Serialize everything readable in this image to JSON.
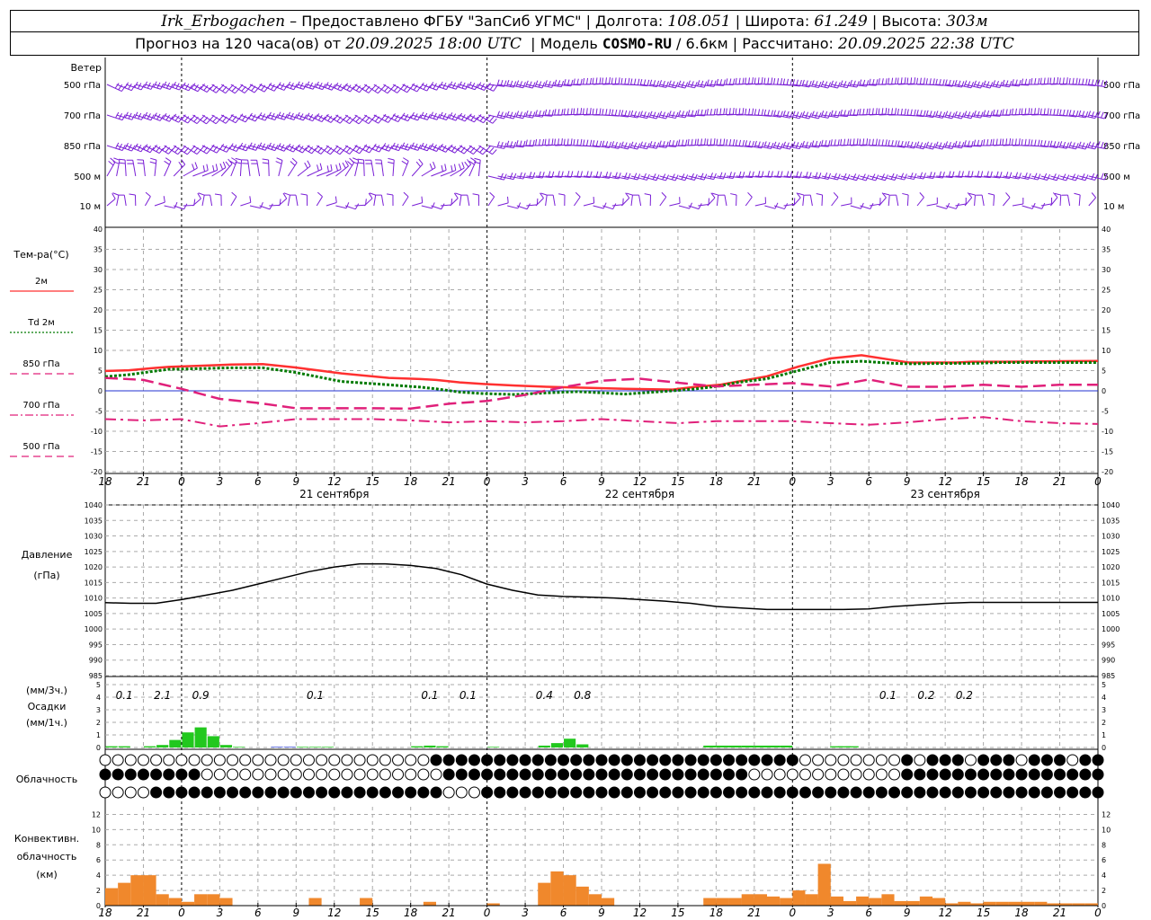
{
  "header": {
    "station": "Irk_Erbogachen",
    "dash": " – ",
    "provided": "Предоставлено ФГБУ \"ЗапСиб УГМС\"",
    "lon_label": "Долгота:",
    "lon": "108.051",
    "lat_label": "Широта:",
    "lat": "61.249",
    "alt_label": "Высота:",
    "alt": "303м",
    "forecast": "Прогноз на 120 часа(ов) от",
    "start": "20.09.2025 18:00 UTC",
    "model_label": "Модель",
    "model": "COSMO-RU",
    "res": " / 6.6км",
    "calc_label": "Рассчитано:",
    "calc": "20.09.2025 22:38 UTC"
  },
  "wind_panel": {
    "title": "Ветер",
    "levels": [
      "500 гПа",
      "700 гПа",
      "850 гПа",
      "500 м",
      "10  м"
    ]
  },
  "temp_panel": {
    "title": "Тем-ра(°C)",
    "legend": [
      {
        "label": "2м",
        "style": "solid",
        "color": "#ff3030"
      },
      {
        "label": "Td  2м",
        "style": "dotted",
        "color": "#007a00"
      },
      {
        "label": "850 гПа",
        "style": "dashed",
        "color": "#e0207a"
      },
      {
        "label": "700 гПа",
        "style": "dashdot",
        "color": "#e0207a"
      },
      {
        "label": "500 гПа",
        "style": "dashed",
        "color": "#e0207a"
      }
    ],
    "ticks": [
      "40",
      "35",
      "30",
      "25",
      "20",
      "15",
      "10",
      "5",
      "0",
      "-5",
      "-10",
      "-15",
      "-20"
    ]
  },
  "time_axis": {
    "hours": [
      "18",
      "21",
      "0",
      "3",
      "6",
      "9",
      "12",
      "15",
      "18",
      "21",
      "0",
      "3",
      "6",
      "9",
      "12",
      "15",
      "18",
      "21",
      "0",
      "3",
      "6",
      "9",
      "12",
      "15",
      "18",
      "21",
      "0"
    ],
    "dates": [
      "21 сентября",
      "22 сентября",
      "23 сентября"
    ]
  },
  "pressure_panel": {
    "title": "Давление",
    "unit": "(гПа)",
    "ticks": [
      "1040",
      "1035",
      "1030",
      "1025",
      "1020",
      "1015",
      "1010",
      "1005",
      "1000",
      "995",
      "990",
      "985"
    ]
  },
  "precip_panel": {
    "unit3": "(мм/3ч.)",
    "title": "Осадки",
    "unit1": "(мм/1ч.)",
    "ticks": [
      "5",
      "4",
      "3",
      "2",
      "1",
      "0"
    ],
    "totals_3h": [
      {
        "h": 1.5,
        "text": "0.1"
      },
      {
        "h": 4.5,
        "text": "2.1"
      },
      {
        "h": 7.5,
        "text": "0.9"
      },
      {
        "h": 16.5,
        "text": "0.1"
      },
      {
        "h": 25.5,
        "text": "0.1"
      },
      {
        "h": 28.5,
        "text": "0.1"
      },
      {
        "h": 34.5,
        "text": "0.4"
      },
      {
        "h": 37.5,
        "text": "0.8"
      },
      {
        "h": 61.5,
        "text": "0.1"
      },
      {
        "h": 64.5,
        "text": "0.2"
      },
      {
        "h": 67.5,
        "text": "0.2"
      },
      {
        "h": 94.5,
        "text": "0.1"
      }
    ]
  },
  "cloud_panel": {
    "title": "Облачность"
  },
  "conv_panel": {
    "title1": "Конвективн.",
    "title2": "облачность",
    "unit": "(км)",
    "ticks": [
      "12",
      "10",
      "8",
      "6",
      "4",
      "2",
      "0"
    ]
  },
  "chart_data": {
    "type": "line",
    "x_unit": "hours since 20.09.2025 18:00 UTC",
    "x_range": [
      0,
      78
    ],
    "temperature": {
      "ylim": [
        -20,
        40
      ],
      "series": [
        {
          "name": "2м",
          "x": [
            0,
            3,
            6,
            8,
            12,
            16,
            20,
            24,
            30,
            36,
            40,
            42,
            45,
            48,
            52,
            56,
            60,
            66,
            72,
            75,
            78,
            80,
            84,
            88,
            92,
            96,
            100,
            102,
            108,
            110,
            114,
            120,
            126
          ],
          "values": [
            4.9,
            5.1,
            5.6,
            5.9,
            6.2,
            6.5,
            6.6,
            5.8,
            4.3,
            3.2,
            2.9,
            2.7,
            2.1,
            1.7,
            1.3,
            1.0,
            0.8,
            0.5,
            0.3,
            1.0,
            1.5,
            2.2,
            3.6,
            6.0,
            8.0,
            8.8,
            7.6,
            7.0,
            7.0,
            7.2,
            7.2,
            7.3,
            7.4
          ]
        },
        {
          "name": "Td  2м",
          "x": [
            0,
            3,
            6,
            8,
            12,
            16,
            20,
            24,
            30,
            36,
            40,
            42,
            45,
            48,
            52,
            56,
            60,
            66,
            72,
            75,
            78,
            80,
            84,
            88,
            92,
            96,
            100,
            102,
            108,
            110,
            114,
            120,
            126
          ],
          "values": [
            3.5,
            4.0,
            4.8,
            5.3,
            5.5,
            5.7,
            5.7,
            4.6,
            2.3,
            1.5,
            0.9,
            0.5,
            -0.3,
            -0.7,
            -0.9,
            -0.5,
            -0.2,
            -0.8,
            0.0,
            0.5,
            1.2,
            2.0,
            3.0,
            5.0,
            7.0,
            7.3,
            6.8,
            6.7,
            6.8,
            6.8,
            7.0,
            7.0,
            7.0
          ]
        },
        {
          "name": "850 гПа",
          "x": [
            0,
            3,
            6,
            9,
            12,
            15,
            18,
            21,
            24,
            27,
            30,
            33,
            36,
            39,
            42,
            45,
            48,
            51,
            54,
            57,
            60,
            63,
            66,
            69,
            72,
            75,
            78
          ],
          "values": [
            3.2,
            2.7,
            0.5,
            -2.0,
            -3.0,
            -4.3,
            -4.3,
            -4.3,
            -4.4,
            -3.2,
            -2.5,
            -1.0,
            0.9,
            2.5,
            3.0,
            2.0,
            1.1,
            1.5,
            1.9,
            1.1,
            2.8,
            1.0,
            1.0,
            1.5,
            1.0,
            1.5,
            1.5
          ]
        },
        {
          "name": "700 гПа",
          "x": [
            0,
            3,
            6,
            9,
            12,
            15,
            18,
            21,
            24,
            27,
            30,
            33,
            36,
            39,
            42,
            45,
            48,
            51,
            54,
            57,
            60,
            63,
            66,
            69,
            72,
            75,
            78
          ],
          "values": [
            -7.0,
            -7.3,
            -7.0,
            -8.8,
            -8.0,
            -7.0,
            -7.0,
            -7.0,
            -7.3,
            -7.8,
            -7.5,
            -7.8,
            -7.5,
            -7.0,
            -7.5,
            -8.0,
            -7.5,
            -7.5,
            -7.5,
            -8.0,
            -8.4,
            -7.8,
            -7.0,
            -6.5,
            -7.5,
            -8.0,
            -8.2
          ]
        }
      ]
    },
    "pressure": {
      "ylim": [
        985,
        1040
      ],
      "series": [
        {
          "name": "Давление",
          "x": [
            0,
            2,
            4,
            6,
            8,
            10,
            12,
            14,
            16,
            18,
            20,
            22,
            24,
            26,
            28,
            30,
            32,
            34,
            36,
            38,
            40,
            42,
            44,
            46,
            48,
            50,
            52,
            54,
            56,
            58,
            60,
            62,
            64,
            66,
            68,
            70,
            72,
            74,
            76,
            78
          ],
          "values": [
            1008.5,
            1008.3,
            1008.3,
            1009.5,
            1011,
            1012.5,
            1014.5,
            1016.5,
            1018.5,
            1020,
            1021,
            1021,
            1020.5,
            1019.5,
            1017.5,
            1014.5,
            1012.5,
            1011,
            1010.5,
            1010.3,
            1010,
            1009.5,
            1009,
            1008.3,
            1007.3,
            1006.8,
            1006.3,
            1006.3,
            1006.3,
            1006.3,
            1006.5,
            1007.3,
            1007.8,
            1008.3,
            1008.6,
            1008.6,
            1008.6,
            1008.6,
            1008.6,
            1008.6
          ]
        }
      ]
    },
    "precipitation_1h": {
      "ylim": [
        0,
        5
      ],
      "x": [
        1,
        2,
        3,
        4,
        5,
        6,
        7,
        8,
        9,
        10,
        11,
        13,
        14,
        15,
        16,
        17,
        18,
        19,
        20,
        21,
        22,
        23,
        24,
        25,
        26,
        27,
        28,
        29,
        30,
        31,
        32,
        33,
        34,
        35,
        36,
        37,
        38
      ],
      "values": [
        0.1,
        0.1,
        0.0,
        0.1,
        0.2,
        0.6,
        1.2,
        1.6,
        0.9,
        0.2,
        0.05,
        0.0,
        0.05,
        0.05,
        0.05,
        0.05,
        0.05,
        0.0,
        0.0,
        0.0,
        0.0,
        0.0,
        0.0,
        0.1,
        0.15,
        0.1,
        0.0,
        0.0,
        0.0,
        0.05,
        0.0,
        0.0,
        0.0,
        0.15,
        0.35,
        0.7,
        0.25
      ]
    },
    "cloud_cover_levels": [
      "high",
      "middle",
      "low"
    ],
    "convective_cloud_km": {
      "ylim": [
        0,
        13
      ],
      "x": [
        0,
        1,
        2,
        3,
        4,
        5,
        6,
        7,
        8,
        9,
        10,
        11,
        12,
        13,
        14,
        15,
        16,
        17,
        18,
        19,
        20,
        21,
        22,
        23,
        24,
        25,
        26,
        27,
        28,
        29,
        30,
        31,
        32,
        33,
        34,
        35,
        36,
        37,
        38,
        39,
        40,
        41,
        42,
        43,
        44,
        45,
        46,
        47,
        48,
        49,
        50,
        51,
        52,
        53,
        54,
        55,
        56,
        57,
        58,
        59,
        60,
        61,
        62,
        63,
        64,
        65,
        66,
        67,
        68,
        69,
        70,
        71,
        72,
        73,
        74,
        75,
        76,
        77
      ],
      "values": [
        2.3,
        3.0,
        4.0,
        4.0,
        1.5,
        1.0,
        0.5,
        1.5,
        1.5,
        1.0,
        0,
        0,
        0,
        0,
        0,
        0,
        1.0,
        0,
        0,
        0,
        1.0,
        0,
        0,
        0,
        0,
        0.5,
        0,
        0,
        0,
        0,
        0.3,
        0,
        0,
        0,
        0,
        0,
        0,
        0,
        0,
        0,
        0,
        0,
        0,
        0,
        0,
        0,
        0,
        1.0,
        1.0,
        1.0,
        1.0,
        1.0,
        0.6,
        1.0,
        2.0,
        1.5,
        1.0,
        1.2,
        0.6,
        1.2,
        1.0,
        1.5,
        0.6,
        0.6,
        1.2,
        1.0,
        0.3,
        0.5,
        0.3,
        0.5,
        0.5,
        0.5,
        0.5,
        0.5,
        0.3,
        0.3,
        0.3,
        0.3
      ]
    }
  }
}
